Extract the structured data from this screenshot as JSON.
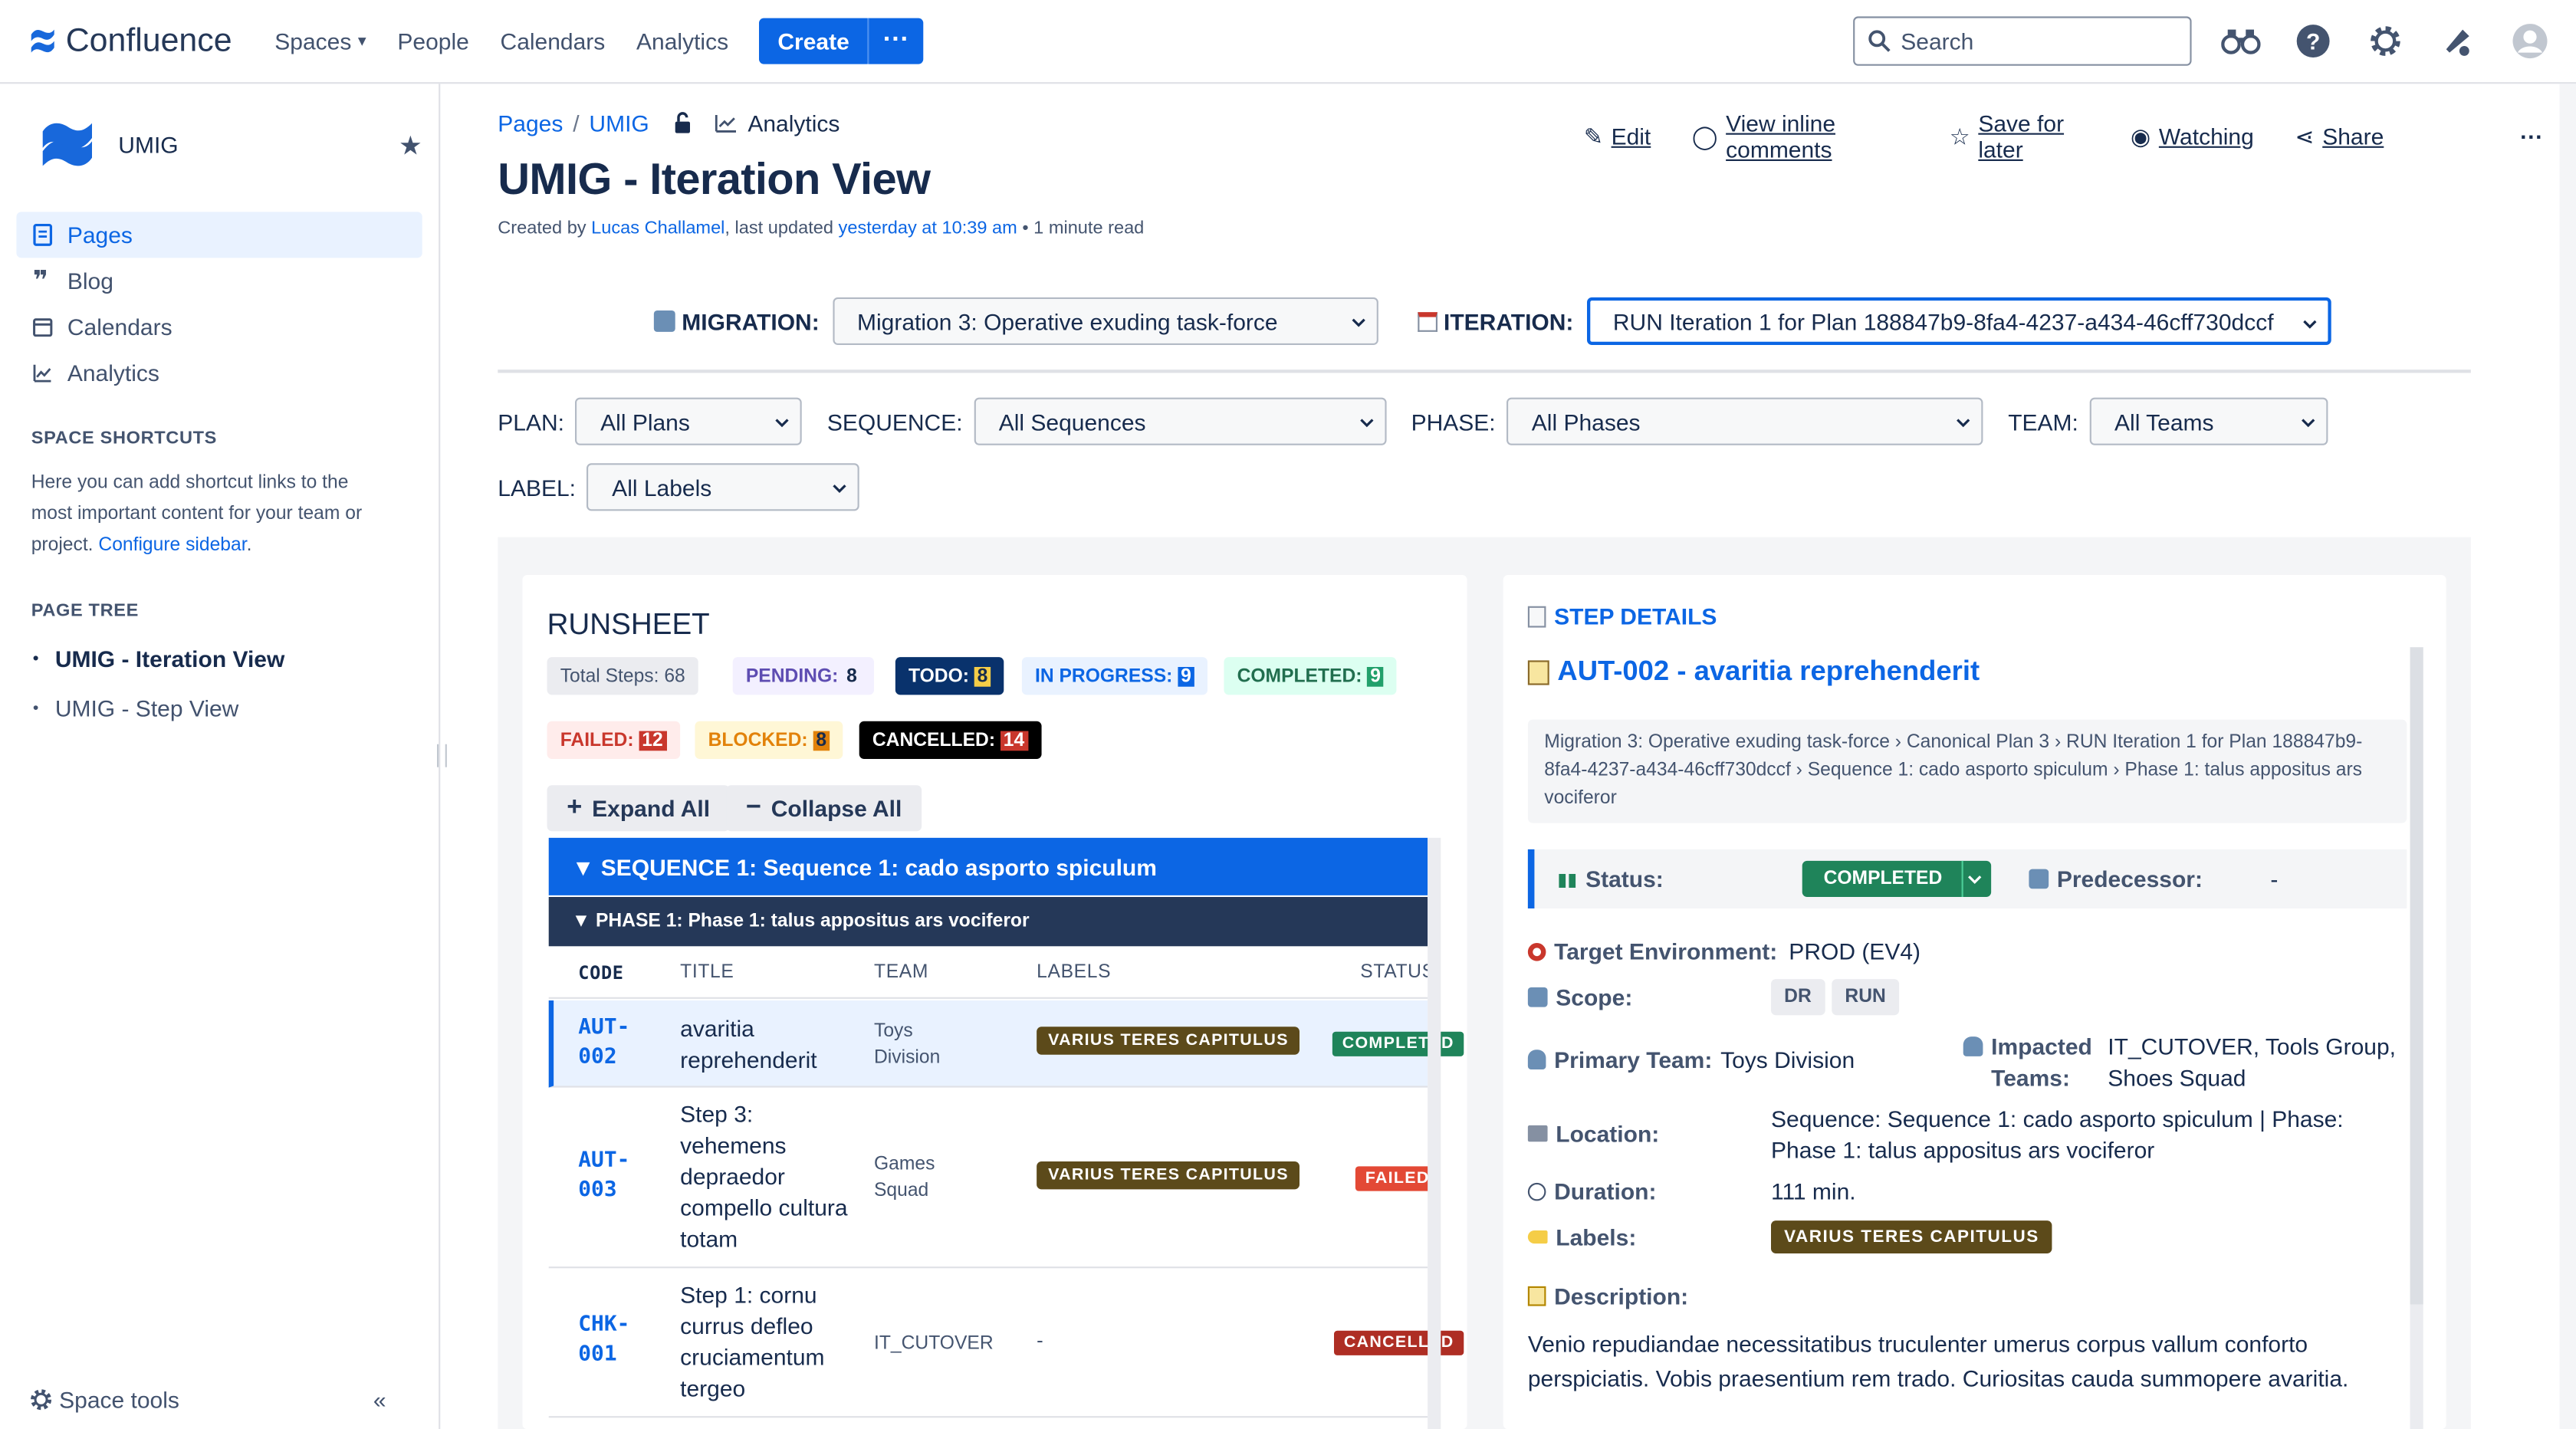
{
  "nav": {
    "brand": "Confluence",
    "items": [
      "Spaces",
      "People",
      "Calendars",
      "Analytics"
    ],
    "create_label": "Create",
    "more_label": "···",
    "search_placeholder": "Search"
  },
  "sidebar": {
    "space_name": "UMIG",
    "items": [
      {
        "label": "Pages",
        "icon": "page-icon",
        "active": true
      },
      {
        "label": "Blog",
        "icon": "quote-icon"
      },
      {
        "label": "Calendars",
        "icon": "calendar-icon"
      },
      {
        "label": "Analytics",
        "icon": "analytics-icon"
      }
    ],
    "shortcuts_heading": "SPACE SHORTCUTS",
    "shortcuts_text": "Here you can add shortcut links to the most important content for your team or project.",
    "configure_link": "Configure sidebar",
    "tree_heading": "PAGE TREE",
    "tree": [
      "UMIG - Iteration View",
      "UMIG - Step View"
    ],
    "space_tools": "Space tools",
    "collapse": "«"
  },
  "page": {
    "crumb_pages": "Pages",
    "crumb_space": "UMIG",
    "crumb_analytics": "Analytics",
    "actions": {
      "edit": "Edit",
      "comments": "View inline comments",
      "save": "Save for later",
      "watching": "Watching",
      "share": "Share",
      "more": "···"
    },
    "title": "UMIG - Iteration View",
    "byline_prefix": "Created by",
    "author": "Lucas Challamel",
    "byline_mid": ", last updated",
    "updated": "yesterday at 10:39 am",
    "read_time": "• 1 minute read"
  },
  "selectors": {
    "migration_label": "MIGRATION:",
    "migration_value": "Migration 3: Operative exuding task-force",
    "iteration_label": "ITERATION:",
    "iteration_value": "RUN Iteration 1 for Plan 188847b9-8fa4-4237-a434-46cff730dccf"
  },
  "filters": {
    "plan_label": "PLAN:",
    "plan_value": "All Plans",
    "sequence_label": "SEQUENCE:",
    "sequence_value": "All Sequences",
    "phase_label": "PHASE:",
    "phase_value": "All Phases",
    "team_label": "TEAM:",
    "team_value": "All Teams",
    "label_label": "LABEL:",
    "label_value": "All Labels"
  },
  "runsheet": {
    "title": "RUNSHEET",
    "total": "Total Steps: 68",
    "pending_label": "PENDING:",
    "pending_count": "8",
    "todo_label": "TODO:",
    "todo_count": "8",
    "inprogress_label": "IN PROGRESS:",
    "inprogress_count": "9",
    "completed_label": "COMPLETED:",
    "completed_count": "9",
    "failed_label": "FAILED:",
    "failed_count": "12",
    "blocked_label": "BLOCKED:",
    "blocked_count": "8",
    "cancelled_label": "CANCELLED:",
    "cancelled_count": "14",
    "expand_all": "Expand All",
    "collapse_all": "Collapse All",
    "sequence": "▼  SEQUENCE 1: Sequence 1: cado asporto spiculum",
    "phase": "▼  PHASE 1: Phase 1: talus appositus ars vociferor",
    "columns": [
      "CODE",
      "TITLE",
      "TEAM",
      "LABELS",
      "STATUS"
    ],
    "rows": [
      {
        "code": "AUT-\n002",
        "title": "avaritia reprehenderit",
        "team": "Toys\nDivision",
        "label": "VARIUS TERES CAPITULUS",
        "status": "COMPLETED"
      },
      {
        "code": "AUT-\n003",
        "title": "Step 3: vehemens depraedor compello cultura totam",
        "team": "Games\nSquad",
        "label": "VARIUS TERES CAPITULUS",
        "status": "FAILED"
      },
      {
        "code": "CHK-\n001",
        "title": "Step 1: cornu currus defleo cruciamentum tergeo",
        "team": "IT_CUTOVER",
        "label": "-",
        "status": "CANCELLED"
      }
    ]
  },
  "details": {
    "heading": "STEP DETAILS",
    "step_title": "AUT-002 - avaritia reprehenderit",
    "breadcrumb": "Migration 3: Operative exuding task-force  ›  Canonical Plan 3  ›  RUN Iteration 1 for Plan 188847b9-8fa4-4237-a434-46cff730dccf  ›  Sequence 1: cado asporto spiculum  ›  Phase 1: talus appositus ars vociferor",
    "status_label": "Status:",
    "status_value": "COMPLETED",
    "predecessor_label": "Predecessor:",
    "predecessor_value": "-",
    "target_env_label": "Target Environment:",
    "target_env_value": "PROD (EV4)",
    "scope_label": "Scope:",
    "scope_chips": [
      "DR",
      "RUN"
    ],
    "primary_team_label": "Primary Team:",
    "primary_team_value": "Toys Division",
    "impacted_label": "Impacted Teams:",
    "impacted_value": "IT_CUTOVER, Tools Group, Shoes Squad",
    "location_label": "Location:",
    "location_value": "Sequence: Sequence 1: cado asporto spiculum | Phase: Phase 1: talus appositus ars vociferor",
    "duration_label": "Duration:",
    "duration_value": "111 min.",
    "labels_label": "Labels:",
    "labels_value": "VARIUS TERES CAPITULUS",
    "description_label": "Description:",
    "description_value": "Venio repudiandae necessitatibus truculenter umerus corpus vallum conforto perspiciatis. Vobis praesentium rem trado. Curiositas cauda summopere avaritia."
  }
}
